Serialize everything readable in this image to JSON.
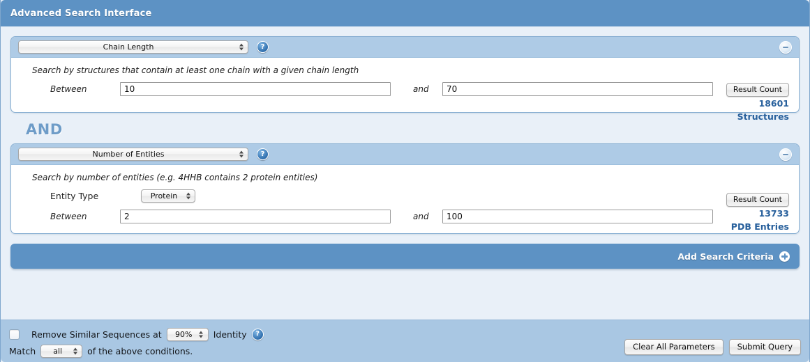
{
  "window": {
    "title": "Advanced Search Interface",
    "accent_color": "#5d92c4",
    "panel_header_color": "#aecbe6",
    "footer_color": "#a9c7e3",
    "result_text_color": "#28609c"
  },
  "criteria": [
    {
      "type_select": "Chain Length",
      "help_icon": "help-circle-icon",
      "collapse_icon": "minus-circle-icon",
      "description": "Search by structures that contain at least one chain with a given chain length",
      "between_label": "Between",
      "min_value": "10",
      "and_label": "and",
      "max_value": "70",
      "result_button": "Result Count",
      "result_number": "18601",
      "result_unit": "Structures"
    },
    {
      "type_select": "Number of Entities",
      "help_icon": "help-circle-icon",
      "collapse_icon": "minus-circle-icon",
      "description": "Search by number of entities (e.g. 4HHB contains 2 protein entities)",
      "entity_type_label": "Entity Type",
      "entity_type_value": "Protein",
      "between_label": "Between",
      "min_value": "2",
      "and_label": "and",
      "max_value": "100",
      "result_button": "Result Count",
      "result_number": "13733",
      "result_unit": "PDB Entries"
    }
  ],
  "operator": "AND",
  "add_bar": {
    "label": "Add Search Criteria",
    "icon": "plus-circle-icon"
  },
  "footer": {
    "remove_similar_label": "Remove Similar Sequences at",
    "identity_value": "90%",
    "identity_label": "Identity",
    "identity_help_icon": "help-circle-icon",
    "match_label": "Match",
    "match_value": "all",
    "match_suffix": "of the above conditions.",
    "clear_button": "Clear All Parameters",
    "submit_button": "Submit Query"
  }
}
